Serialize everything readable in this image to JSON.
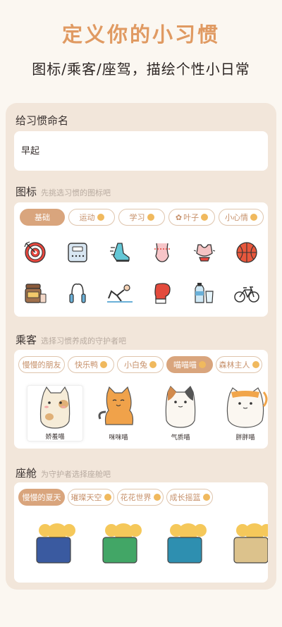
{
  "header": {
    "title": "定义你的小习惯",
    "subtitle": "图标/乘客/座驾，描绘个性小日常"
  },
  "name_section": {
    "label": "给习惯命名",
    "value": "早起"
  },
  "icon_section": {
    "label": "图标",
    "hint": "先挑选习惯的图标吧",
    "tabs": [
      "基础",
      "运动",
      "学习",
      "叶子",
      "小心情"
    ],
    "active_tab": "基础",
    "icons": [
      "target-icon",
      "scale-icon",
      "running-shoe-icon",
      "waist-icon",
      "sports-bra-icon",
      "basketball-icon",
      "protein-jar-icon",
      "jump-rope-icon",
      "situp-icon",
      "boxing-glove-icon",
      "water-bottle-icon",
      "bicycle-icon"
    ]
  },
  "passenger_section": {
    "label": "乘客",
    "hint": "选择习惯养成的守护者吧",
    "tabs": [
      "慢慢的朋友",
      "快乐鸭",
      "小白兔",
      "喵喵喵",
      "森林主人"
    ],
    "active_tab": "喵喵喵",
    "pets": [
      {
        "name": "娇羞喵"
      },
      {
        "name": "咪咪喵"
      },
      {
        "name": "气质喵"
      },
      {
        "name": "胖胖喵"
      }
    ]
  },
  "vehicle_section": {
    "label": "座舱",
    "hint": "为守护者选择座舱吧",
    "tabs": [
      "慢慢的夏天",
      "璀璨天空",
      "花花世界",
      "成长摇篮"
    ],
    "active_tab": "慢慢的夏天",
    "cabins": [
      {
        "color": "#3a5aa0"
      },
      {
        "color": "#42a666"
      },
      {
        "color": "#2e8fb0"
      },
      {
        "color": "#dcc28c"
      }
    ]
  },
  "colors": {
    "accent": "#e09a62",
    "chip_active": "#d9a57d",
    "panel": "#f2e6da"
  }
}
